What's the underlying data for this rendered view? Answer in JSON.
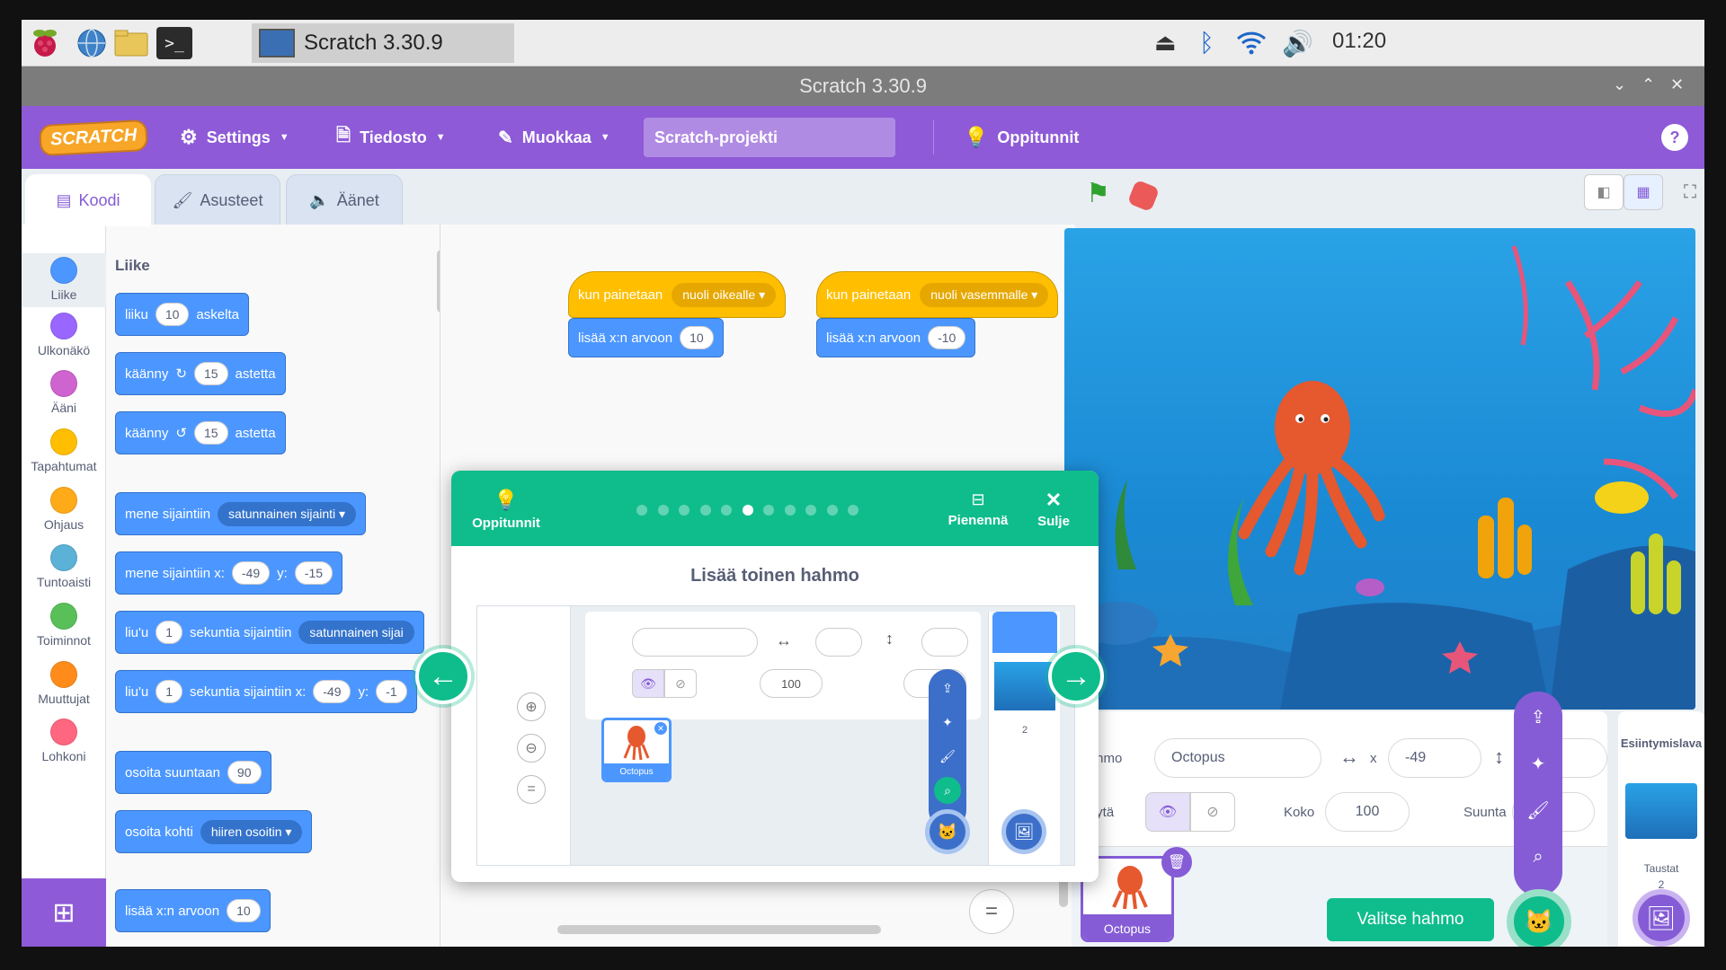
{
  "taskbar": {
    "window_title": "Scratch 3.30.9",
    "clock": "01:20"
  },
  "window": {
    "title": "Scratch 3.30.9"
  },
  "menubar": {
    "logo": "SCRATCH",
    "settings": "Settings",
    "file": "Tiedosto",
    "edit": "Muokkaa",
    "project_name": "Scratch-projekti",
    "tutorials": "Oppitunnit",
    "help": "?"
  },
  "tabs": {
    "code": "Koodi",
    "costumes": "Asusteet",
    "sounds": "Äänet"
  },
  "categories": [
    {
      "label": "Liike",
      "color": "#4c97ff"
    },
    {
      "label": "Ulkonäkö",
      "color": "#9966ff"
    },
    {
      "label": "Ääni",
      "color": "#cf63cf"
    },
    {
      "label": "Tapahtumat",
      "color": "#ffbf00"
    },
    {
      "label": "Ohjaus",
      "color": "#ffab19"
    },
    {
      "label": "Tuntoaisti",
      "color": "#5cb1d6"
    },
    {
      "label": "Toiminnot",
      "color": "#59c059"
    },
    {
      "label": "Muuttujat",
      "color": "#ff8c1a"
    },
    {
      "label": "Lohkoni",
      "color": "#ff6680"
    }
  ],
  "palette": {
    "heading": "Liike",
    "b1": {
      "a": "liiku",
      "v": "10",
      "b": "askelta"
    },
    "b2": {
      "a": "käänny",
      "v": "15",
      "b": "astetta"
    },
    "b3": {
      "a": "käänny",
      "v": "15",
      "b": "astetta"
    },
    "b4": {
      "a": "mene sijaintiin",
      "d": "satunnainen sijainti"
    },
    "b5": {
      "a": "mene sijaintiin x:",
      "x": "-49",
      "y_lbl": "y:",
      "y": "-15"
    },
    "b6": {
      "a": "liu'u",
      "v": "1",
      "b": "sekuntia sijaintiin",
      "d": "satunnainen sijai"
    },
    "b7": {
      "a": "liu'u",
      "v": "1",
      "b": "sekuntia sijaintiin x:",
      "x": "-49",
      "y_lbl": "y:",
      "y": "-1"
    },
    "b8": {
      "a": "osoita suuntaan",
      "v": "90"
    },
    "b9": {
      "a": "osoita kohti",
      "d": "hiiren osoitin"
    },
    "b10": {
      "a": "lisää x:n arvoon",
      "v": "10"
    }
  },
  "scripts": [
    {
      "hat": "kun painetaan",
      "key": "nuoli oikealle",
      "cmd": "lisää x:n arvoon",
      "val": "10"
    },
    {
      "hat": "kun painetaan",
      "key": "nuoli vasemmalle",
      "cmd": "lisää x:n arvoon",
      "val": "-10"
    }
  ],
  "tutorial": {
    "label": "Oppitunnit",
    "shrink": "Pienennä",
    "close": "Sulje",
    "title": "Lisää toinen hahmo",
    "steps_total": 11,
    "current_step": 6,
    "sprite_name": "Octopus",
    "size": "100",
    "backdrop_count": "2"
  },
  "sprite_info": {
    "sprite_label": "Hahmo",
    "sprite_name": "Octopus",
    "x_label": "x",
    "x": "-49",
    "y_label": "y",
    "show_label": "Näytä",
    "size_label": "Koko",
    "size": "100",
    "direction_label": "Suunta",
    "thumb_name": "Octopus"
  },
  "stage_panel": {
    "title": "Esiintymislava",
    "backdrops": "Taustat",
    "count": "2"
  },
  "tooltip": "Valitse hahmo"
}
